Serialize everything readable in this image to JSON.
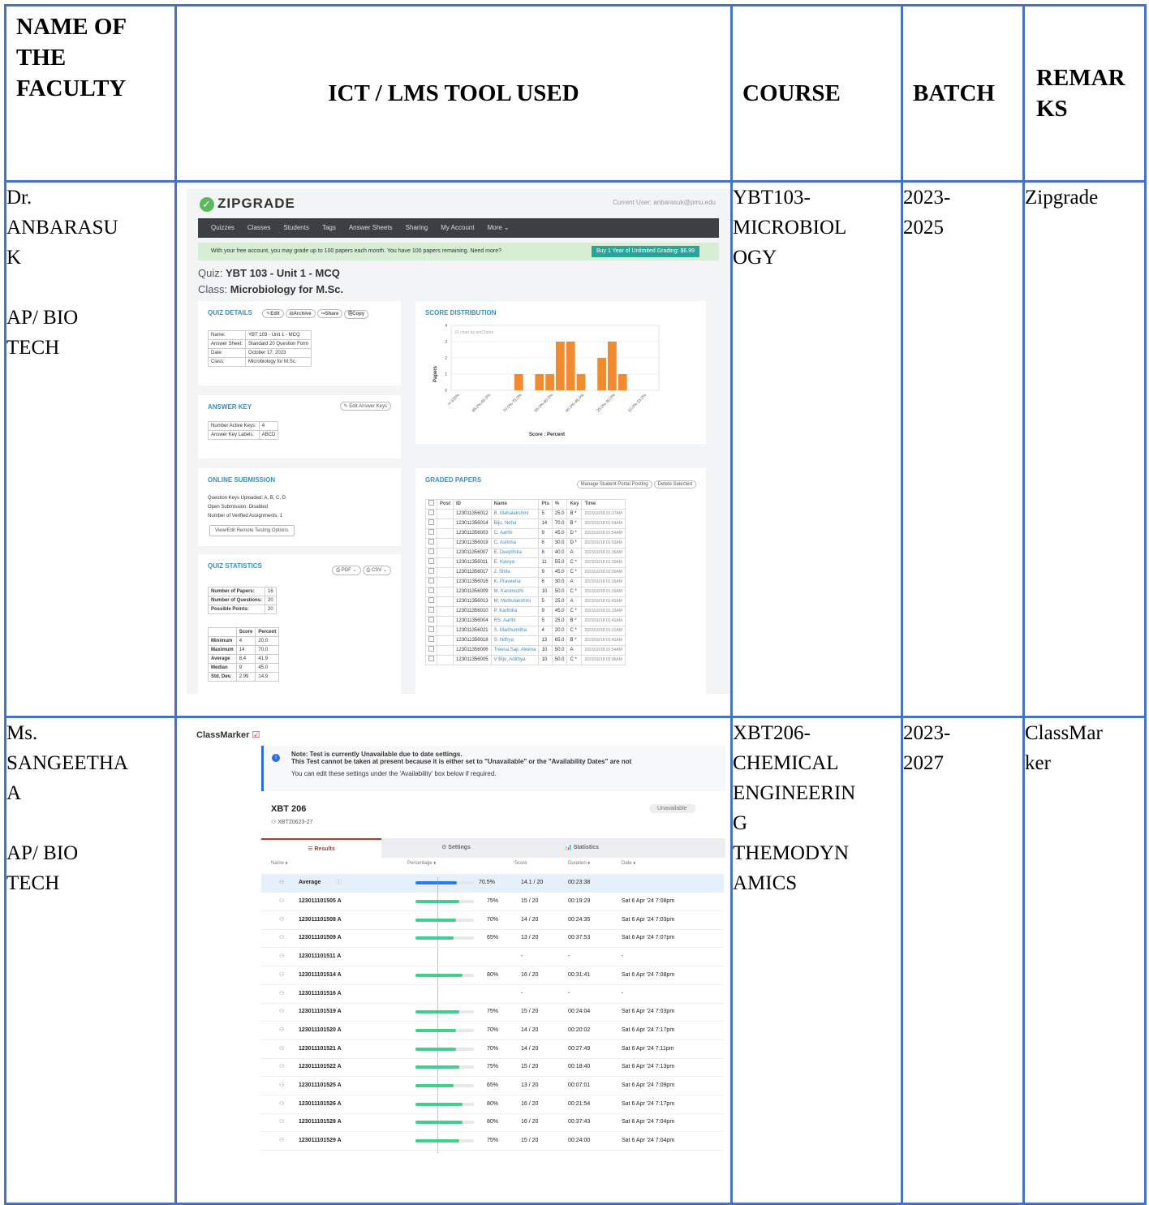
{
  "headers": [
    "NAME OF THE FACULTY",
    "ICT / LMS TOOL USED",
    "COURSE",
    "BATCH",
    "REMAR KS"
  ],
  "rows": [
    {
      "name_lines": [
        "Dr.",
        "ANBARASU",
        "K"
      ],
      "dept_lines": [
        "AP/ BIO",
        "TECH"
      ],
      "course_lines": [
        "YBT103-",
        "MICROBIOL",
        "OGY"
      ],
      "batch_lines": [
        "2023-",
        "2025"
      ],
      "remarks": "Zipgrade"
    },
    {
      "name_lines": [
        "Ms.",
        "SANGEETHA",
        "A"
      ],
      "dept_lines": [
        "AP/ BIO",
        "TECH"
      ],
      "course_lines": [
        "XBT206-",
        "CHEMICAL",
        "ENGINEERIN",
        "G",
        "THEMODYN",
        "AMICS"
      ],
      "batch_lines": [
        "2023-",
        "2027"
      ],
      "remarks_lines": [
        "ClassMar",
        "ker"
      ]
    }
  ],
  "zipgrade": {
    "logo": "ZIPGRADE",
    "current_user": "Current User: anbarasuk@pmu.edu",
    "nav": [
      "Quizzes",
      "Classes",
      "Students",
      "Tags",
      "Answer Sheets",
      "Sharing",
      "My Account",
      "More ⌄"
    ],
    "banner": "With your free account, you may grade up to 100 papers each month. You have 100 papers remaining. Need more?",
    "buy": "Buy 1 Year of Unlimited Grading: $6.99",
    "quiz_label": "Quiz:",
    "quiz": "YBT 103 - Unit 1 - MCQ",
    "class_label": "Class:",
    "class": "Microbiology for M.Sc.",
    "quiz_details": {
      "title": "QUIZ DETAILS",
      "buttons": [
        "✎Edit",
        "⊟Archive",
        "↪Share",
        "⎘Copy"
      ],
      "rows": [
        [
          "Name:",
          "YBT 103 - Unit 1 - MCQ"
        ],
        [
          "Answer Sheet:",
          "Standard 20 Question Form"
        ],
        [
          "Date:",
          "October 17, 2023"
        ],
        [
          "Class:",
          "Microbiology for M.Sc."
        ]
      ]
    },
    "answer_key": {
      "title": "ANSWER KEY",
      "button": "✎ Edit Answer Keys",
      "rows": [
        [
          "Number Active Keys:",
          "4"
        ],
        [
          "Answer Key Labels:",
          "ABCD"
        ]
      ]
    },
    "online": {
      "title": "ONLINE SUBMISSION",
      "lines": [
        "Question Keys Uploaded: A, B, C, D",
        "Open Submission: Disabled",
        "Number of Verified Assignments: 1"
      ],
      "button": "View/Edit Remote Testing Options"
    },
    "stats": {
      "title": "QUIZ STATISTICS",
      "buttons": [
        "⎙ PDF ⌄",
        "⎙ CSV ⌄"
      ],
      "counts": [
        [
          "Number of Papers:",
          "16"
        ],
        [
          "Number of Questions:",
          "20"
        ],
        [
          "Possible Points:",
          "20"
        ]
      ],
      "head": [
        "",
        "Score",
        "Percent"
      ],
      "rows": [
        [
          "Minimum",
          "4",
          "20.0"
        ],
        [
          "Maximum",
          "14",
          "70.0"
        ],
        [
          "Average",
          "8.4",
          "41.9"
        ],
        [
          "Median",
          "9",
          "45.0"
        ],
        [
          "Std. Dev.",
          "2.99",
          "14.9"
        ]
      ]
    },
    "score_dist": {
      "title": "SCORE DISTRIBUTION",
      "note": "JS chart by amCharts",
      "ylabel": "Papers",
      "xlabel": "Score : Percent"
    },
    "graded": {
      "title": "GRADED PAPERS",
      "buttons": [
        "Manage Student Portal Posting",
        "Delete Selected"
      ],
      "head": [
        "",
        "Post",
        "ID",
        "Name",
        "Pts",
        "%",
        "Key",
        "Time"
      ],
      "rows": [
        [
          "123011356012",
          "B. Mahalakshmi",
          "5",
          "25.0",
          "B *",
          "2023/10/18 01:27AM"
        ],
        [
          "123011356014",
          "Biju, Neha",
          "14",
          "70.0",
          "B *",
          "2023/10/18 01:54AM"
        ],
        [
          "123011356003",
          "C. Aarthi",
          "9",
          "45.0",
          "D *",
          "2023/10/18 01:54AM"
        ],
        [
          "123011356019",
          "C. Ashima",
          "6",
          "30.0",
          "D *",
          "2023/10/18 01:53AM"
        ],
        [
          "123011356007",
          "E. Deepthika",
          "8",
          "40.0",
          "A",
          "2023/10/18 01:36AM"
        ],
        [
          "123011356011",
          "E. Kaviya",
          "11",
          "55.0",
          "C *",
          "2023/10/18 01:30AM"
        ],
        [
          "123011356017",
          "J. Shifa",
          "9",
          "45.0",
          "C *",
          "2023/10/18 02:00AM"
        ],
        [
          "123011356016",
          "K. Praveena",
          "6",
          "30.0",
          "A",
          "2023/10/18 01:26AM"
        ],
        [
          "123011356009",
          "M. Kanimozhi",
          "10",
          "50.0",
          "C *",
          "2023/10/18 01:39AM"
        ],
        [
          "123011356013",
          "M. Muthulakshmi",
          "5",
          "25.0",
          "A",
          "2023/10/18 01:42AM"
        ],
        [
          "123011356010",
          "P. Karthika",
          "9",
          "45.0",
          "C *",
          "2023/10/18 01:33AM"
        ],
        [
          "123011356004",
          "RS. Aarthi",
          "5",
          "25.0",
          "B *",
          "2023/10/18 01:42AM"
        ],
        [
          "123011356021",
          "S. Madhumitha",
          "4",
          "20.0",
          "C *",
          "2023/10/18 01:31AM"
        ],
        [
          "123011356018",
          "S. Nithya",
          "13",
          "65.0",
          "B *",
          "2023/10/18 01:42AM"
        ],
        [
          "123011356006",
          "Treesa Saji, Aleena",
          "10",
          "50.0",
          "A",
          "2023/10/18 01:54AM"
        ],
        [
          "123011356005",
          "V Biju, Adithya",
          "10",
          "50.0",
          "C *",
          "2023/10/18 02:06AM"
        ]
      ]
    }
  },
  "chart_data": {
    "type": "bar",
    "title": "",
    "xlabel": "Score : Percent",
    "ylabel": "Papers",
    "ylim": [
      0,
      4
    ],
    "yticks": [
      0,
      1,
      2,
      3,
      4
    ],
    "tick_labels": [
      ">=100%",
      "85.0%-90.0%",
      "70.0%-75.0%",
      "55.0%-60.0%",
      "40.0%-45.0%",
      "25.0%-30.0%",
      "10.0%-15.0%"
    ],
    "values": [
      0,
      0,
      0,
      0,
      0,
      0,
      1,
      0,
      1,
      1,
      3,
      3,
      1,
      0,
      2,
      3,
      1,
      0,
      0,
      0
    ],
    "bar_color": "#f28b30",
    "grid": true
  },
  "classmarker": {
    "brand": "ClassMarker",
    "note_title": "Note: Test is currently Unavailable due to date settings.",
    "note_line2": "This Test cannot be taken at present because it is either set to \"Unavailable\" or the \"Availability Dates\" are not",
    "note_line3": "You can edit these settings under the 'Availability' box below if required.",
    "test_name": "XBT 206",
    "group": "XBT20623-27",
    "status": "Unavailable",
    "tabs": [
      "☰ Results",
      "⚙ Settings",
      "📊 Statistics"
    ],
    "head": [
      "Name ⬧",
      "Percentage ⬧",
      "Score",
      "Duration ⬧",
      "Date ⬧"
    ],
    "average": {
      "name": "Average",
      "pct": "70.5%",
      "pct_value": 70.5,
      "score": "14.1 / 20",
      "duration": "00:23:38"
    },
    "rows": [
      {
        "name": "123011101505 A",
        "pct": "75%",
        "pct_value": 75,
        "score": "15 / 20",
        "duration": "00:19:29",
        "date": "Sat 6 Apr '24 7:08pm"
      },
      {
        "name": "123011101508 A",
        "pct": "70%",
        "pct_value": 70,
        "score": "14 / 20",
        "duration": "00:24:35",
        "date": "Sat 6 Apr '24 7:03pm"
      },
      {
        "name": "123011101509 A",
        "pct": "65%",
        "pct_value": 65,
        "score": "13 / 20",
        "duration": "00:37:53",
        "date": "Sat 6 Apr '24 7:07pm"
      },
      {
        "name": "123011101511 A",
        "pct": "",
        "pct_value": 0,
        "score": "-",
        "duration": "-",
        "date": "-"
      },
      {
        "name": "123011101514 A",
        "pct": "80%",
        "pct_value": 80,
        "score": "16 / 20",
        "duration": "00:31:41",
        "date": "Sat 6 Apr '24 7:08pm"
      },
      {
        "name": "123011101516 A",
        "pct": "",
        "pct_value": 0,
        "score": "-",
        "duration": "-",
        "date": "-"
      },
      {
        "name": "123011101519 A",
        "pct": "75%",
        "pct_value": 75,
        "score": "15 / 20",
        "duration": "00:24:04",
        "date": "Sat 6 Apr '24 7:03pm"
      },
      {
        "name": "123011101520 A",
        "pct": "70%",
        "pct_value": 70,
        "score": "14 / 20",
        "duration": "00:20:02",
        "date": "Sat 6 Apr '24 7:17pm"
      },
      {
        "name": "123011101521 A",
        "pct": "70%",
        "pct_value": 70,
        "score": "14 / 20",
        "duration": "00:27:49",
        "date": "Sat 6 Apr '24 7:11pm"
      },
      {
        "name": "123011101522 A",
        "pct": "75%",
        "pct_value": 75,
        "score": "15 / 20",
        "duration": "00:18:40",
        "date": "Sat 6 Apr '24 7:13pm"
      },
      {
        "name": "123011101525 A",
        "pct": "65%",
        "pct_value": 65,
        "score": "13 / 20",
        "duration": "00:07:01",
        "date": "Sat 6 Apr '24 7:09pm"
      },
      {
        "name": "123011101526 A",
        "pct": "80%",
        "pct_value": 80,
        "score": "16 / 20",
        "duration": "00:21:54",
        "date": "Sat 6 Apr '24 7:17pm"
      },
      {
        "name": "123011101528 A",
        "pct": "80%",
        "pct_value": 80,
        "score": "16 / 20",
        "duration": "00:37:43",
        "date": "Sat 6 Apr '24 7:04pm"
      },
      {
        "name": "123011101529 A",
        "pct": "75%",
        "pct_value": 75,
        "score": "15 / 20",
        "duration": "00:24:00",
        "date": "Sat 6 Apr '24 7:04pm"
      }
    ]
  }
}
